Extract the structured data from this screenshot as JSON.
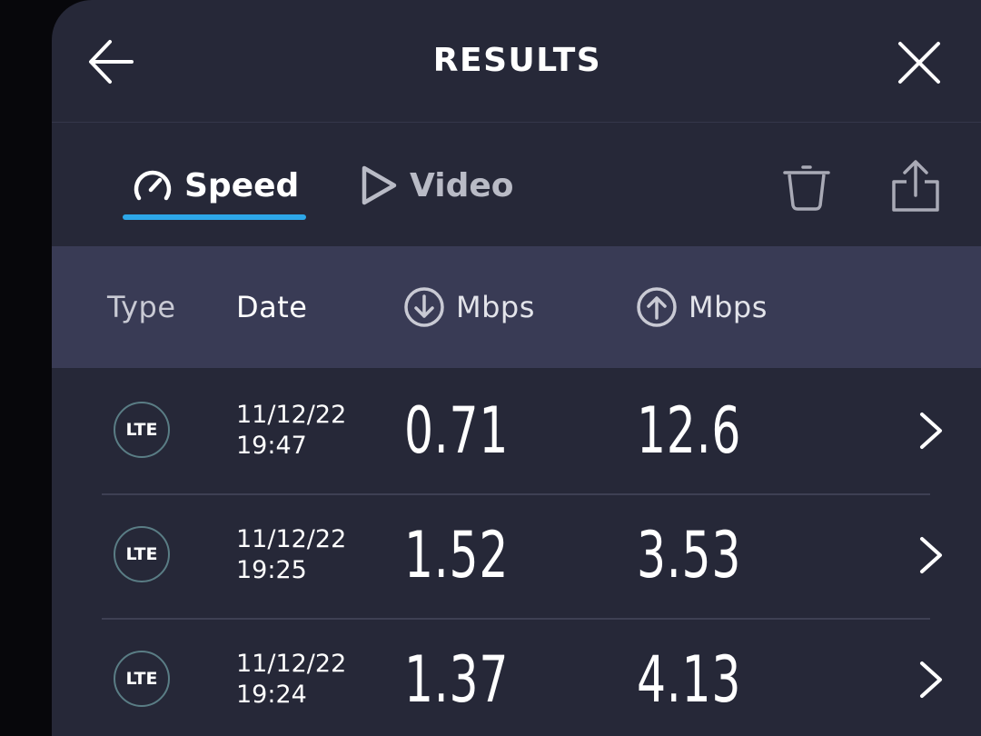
{
  "header": {
    "title": "RESULTS",
    "back_icon": "arrow-left-icon",
    "close_icon": "close-icon"
  },
  "tabs": [
    {
      "label": "Speed",
      "icon": "speedometer-icon",
      "active": true
    },
    {
      "label": "Video",
      "icon": "play-icon",
      "active": false
    }
  ],
  "toolbar": {
    "delete_icon": "trash-icon",
    "share_icon": "share-icon"
  },
  "table": {
    "columns": {
      "type": "Type",
      "date": "Date",
      "download": "Mbps",
      "upload": "Mbps"
    },
    "rows": [
      {
        "type": "LTE",
        "date": "11/12/22",
        "time": "19:47",
        "download": "0.71",
        "upload": "12.6"
      },
      {
        "type": "LTE",
        "date": "11/12/22",
        "time": "19:25",
        "download": "1.52",
        "upload": "3.53"
      },
      {
        "type": "LTE",
        "date": "11/12/22",
        "time": "19:24",
        "download": "1.37",
        "upload": "4.13"
      }
    ]
  },
  "colors": {
    "background": "#262838",
    "header_row": "#393b55",
    "accent": "#2da7e8"
  }
}
